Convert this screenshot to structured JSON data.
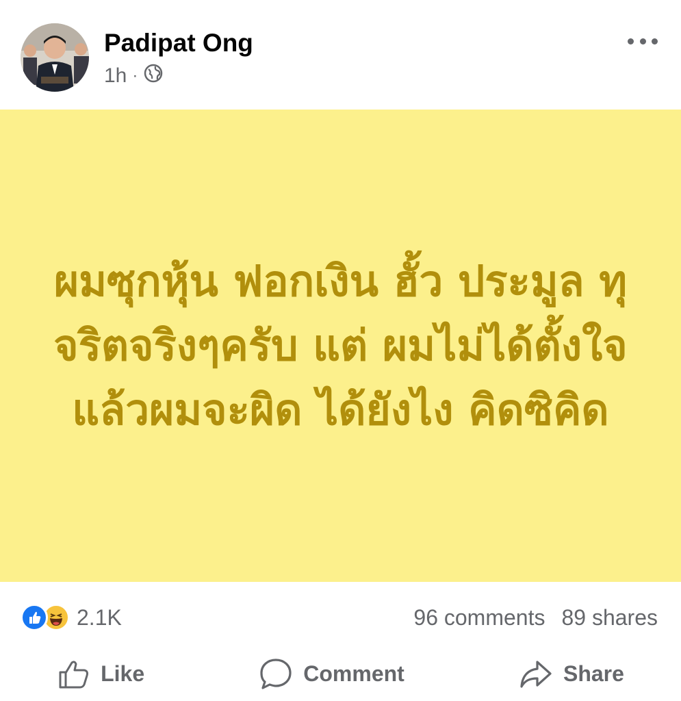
{
  "post": {
    "author": "Padipat Ong",
    "time": "1h",
    "separator": "·",
    "privacy_icon": "globe-icon",
    "menu_icon": "more-icon",
    "body": "ผมซุกหุ้น ฟอกเงิน ฮั้ว ประมูล ทุจริตจริงๆครับ แต่ ผมไม่ได้ตั้งใจ แล้วผมจะผิด ได้ยังไง คิดซิคิด",
    "background_color": "#fcf08c",
    "text_color": "#b18f0c"
  },
  "stats": {
    "reaction_icons": [
      "like-reaction-icon",
      "haha-reaction-icon"
    ],
    "reaction_count": "2.1K",
    "comments": "96 comments",
    "shares": "89 shares"
  },
  "actions": {
    "like_label": "Like",
    "comment_label": "Comment",
    "share_label": "Share"
  }
}
